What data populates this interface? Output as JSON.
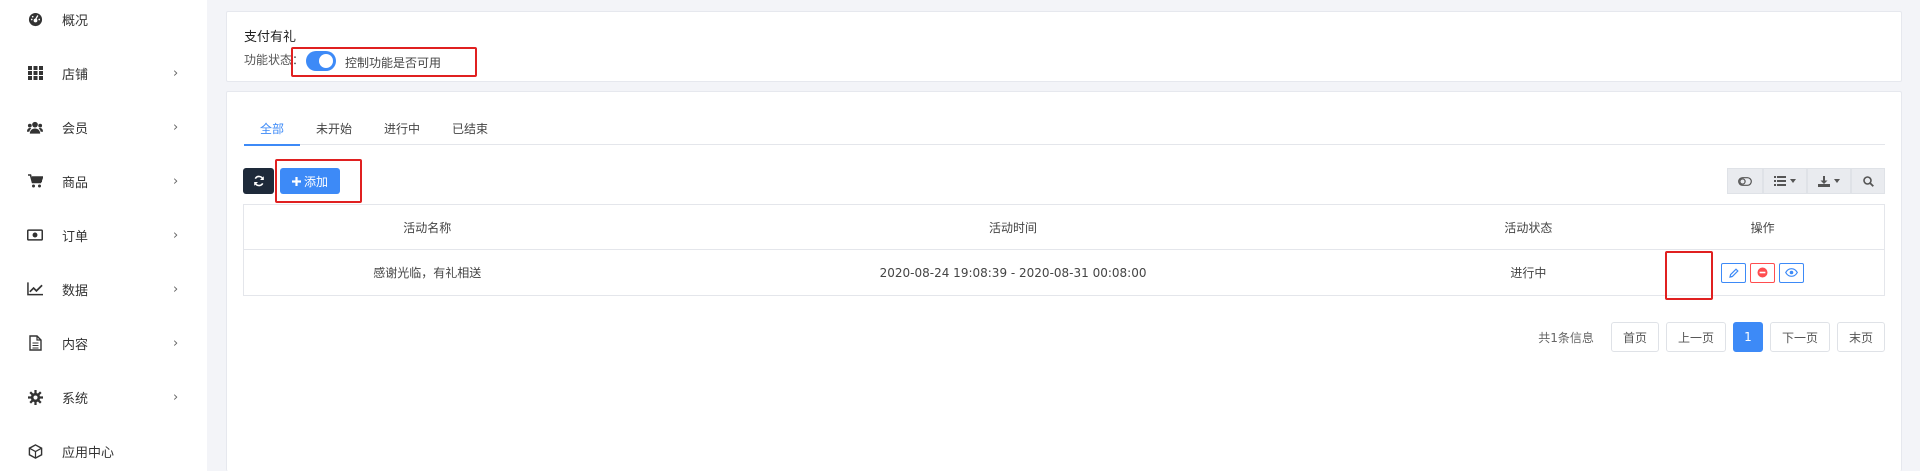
{
  "sidebar": {
    "items": [
      {
        "label": "概况",
        "icon": "dashboard-icon",
        "has_arrow": false
      },
      {
        "label": "店铺",
        "icon": "grid-icon",
        "has_arrow": true
      },
      {
        "label": "会员",
        "icon": "users-icon",
        "has_arrow": true
      },
      {
        "label": "商品",
        "icon": "cart-icon",
        "has_arrow": true
      },
      {
        "label": "订单",
        "icon": "money-icon",
        "has_arrow": true
      },
      {
        "label": "数据",
        "icon": "line-chart-icon",
        "has_arrow": true
      },
      {
        "label": "内容",
        "icon": "document-icon",
        "has_arrow": true
      },
      {
        "label": "系统",
        "icon": "gear-icon",
        "has_arrow": true
      },
      {
        "label": "应用中心",
        "icon": "cube-icon",
        "has_arrow": false
      }
    ],
    "arrow_glyph": "›"
  },
  "feature": {
    "title": "支付有礼",
    "status_label": "功能状态：",
    "toggle_on": true,
    "toggle_text": "控制功能是否可用"
  },
  "tabs": [
    {
      "label": "全部",
      "active": true
    },
    {
      "label": "未开始",
      "active": false
    },
    {
      "label": "进行中",
      "active": false
    },
    {
      "label": "已结束",
      "active": false
    }
  ],
  "toolbar": {
    "refresh_icon": "refresh-icon",
    "add_label": "添加",
    "add_icon": "plus-icon"
  },
  "table": {
    "headers": [
      "活动名称",
      "活动时间",
      "活动状态",
      "操作"
    ],
    "rows": [
      {
        "name": "感谢光临，有礼相送",
        "time": "2020-08-24 19:08:39 - 2020-08-31 00:08:00",
        "status": "进行中"
      }
    ]
  },
  "pagination": {
    "info": "共1条信息",
    "first": "首页",
    "prev": "上一页",
    "current": "1",
    "next": "下一页",
    "last": "末页"
  },
  "colors": {
    "accent": "#3d8af7",
    "highlight_box": "#e02020",
    "dark_button": "#1e2a3a",
    "delete": "#ff4d4f"
  }
}
